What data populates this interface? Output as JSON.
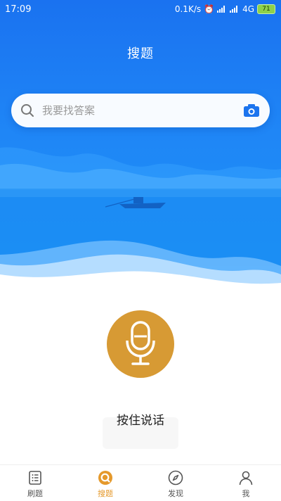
{
  "status_bar": {
    "time": "17:09",
    "speed": "0.1K/s",
    "network": "4G",
    "battery": "71"
  },
  "header": {
    "title": "搜题"
  },
  "search": {
    "placeholder": "我要找答案"
  },
  "voice": {
    "hint": "按住说话"
  },
  "tabs": [
    {
      "label": "刷题",
      "icon": "list-icon"
    },
    {
      "label": "搜题",
      "icon": "search-circle-icon",
      "active": true
    },
    {
      "label": "发现",
      "icon": "compass-icon"
    },
    {
      "label": "我",
      "icon": "person-icon"
    }
  ],
  "colors": {
    "header_blue": "#1f86f6",
    "accent_orange": "#d79a34",
    "active_tab": "#e5992b"
  }
}
